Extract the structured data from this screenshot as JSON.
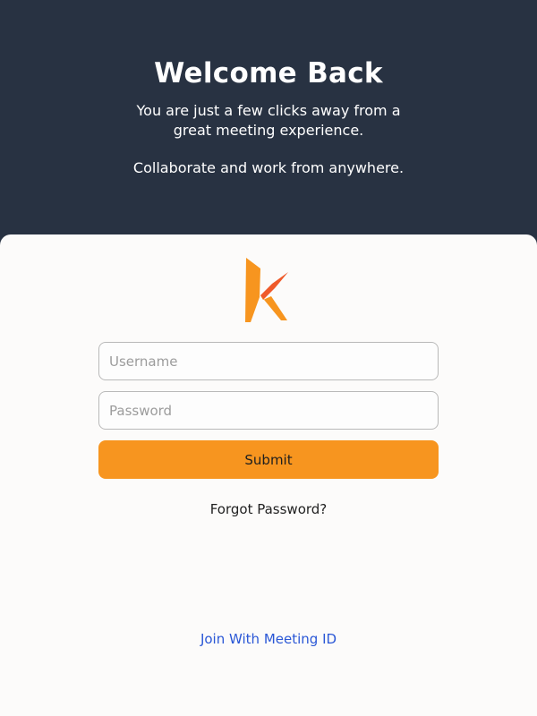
{
  "header": {
    "title": "Welcome Back",
    "subtitle": "You are just a few clicks away from a great meeting experience.",
    "tagline": "Collaborate and work from anywhere."
  },
  "logo": {
    "icon": "k-logo-icon",
    "colors": {
      "primary": "#f7951f",
      "secondary": "#ef5a2a"
    }
  },
  "form": {
    "username_placeholder": "Username",
    "username_value": "",
    "password_placeholder": "Password",
    "password_value": "",
    "submit_label": "Submit",
    "forgot_label": "Forgot Password?",
    "join_label": "Join With Meeting ID"
  },
  "colors": {
    "header_bg": "#283242",
    "card_bg": "#fcfbfa",
    "accent": "#f7951f",
    "link": "#2a57d6"
  }
}
